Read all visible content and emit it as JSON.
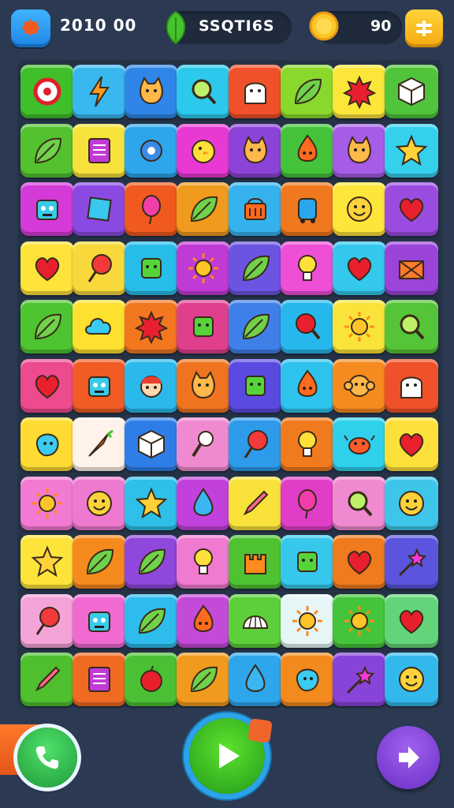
{
  "topbar": {
    "score_text": "2010 00",
    "label": "SSQTI6S",
    "coins": "90"
  },
  "colors": {
    "background": "#2b3a52",
    "board": "#253246"
  },
  "board": {
    "rows": [
      [
        {
          "c": "#3fbf2a",
          "i": "target-icon"
        },
        {
          "c": "#39b8f0",
          "i": "lightning-icon"
        },
        {
          "c": "#2f86e8",
          "i": "cat-face-icon"
        },
        {
          "c": "#2cc9ec",
          "i": "magnifier-icon"
        },
        {
          "c": "#f0502a",
          "i": "ghost-face-icon"
        },
        {
          "c": "#8ad82c",
          "i": "leaf-icon"
        },
        {
          "c": "#fde63a",
          "i": "spiky-ball-icon"
        },
        {
          "c": "#50c43a",
          "i": "cube-icon"
        }
      ],
      [
        {
          "c": "#53c22e",
          "i": "leaf-icon"
        },
        {
          "c": "#f6e23a",
          "i": "note-icon"
        },
        {
          "c": "#2ea6ec",
          "i": "gear-icon"
        },
        {
          "c": "#e83ad2",
          "i": "chick-icon"
        },
        {
          "c": "#8c43d8",
          "i": "cat-face-icon"
        },
        {
          "c": "#44c33a",
          "i": "flame-face-icon"
        },
        {
          "c": "#a65ce6",
          "i": "cat-face-icon"
        },
        {
          "c": "#35d0ec",
          "i": "star-icon"
        }
      ],
      [
        {
          "c": "#d43ad8",
          "i": "robot-icon"
        },
        {
          "c": "#8a4ae2",
          "i": "gem-icon"
        },
        {
          "c": "#f05a1e",
          "i": "balloon-icon"
        },
        {
          "c": "#f09a1e",
          "i": "leaf-icon"
        },
        {
          "c": "#35b2ee",
          "i": "basket-icon"
        },
        {
          "c": "#f0781e",
          "i": "lantern-icon"
        },
        {
          "c": "#fde63a",
          "i": "smiley-icon"
        },
        {
          "c": "#9a4ce0",
          "i": "heart-icon"
        }
      ],
      [
        {
          "c": "#fde33a",
          "i": "heart-icon"
        },
        {
          "c": "#f8d83a",
          "i": "lollipop-icon"
        },
        {
          "c": "#27bde8",
          "i": "square-face-icon"
        },
        {
          "c": "#c03ad6",
          "i": "sun-icon"
        },
        {
          "c": "#6c54e2",
          "i": "leaf-icon"
        },
        {
          "c": "#ef4fd6",
          "i": "bulb-icon"
        },
        {
          "c": "#33c8ec",
          "i": "heart-icon"
        },
        {
          "c": "#9a44da",
          "i": "box-icon"
        }
      ],
      [
        {
          "c": "#4fc431",
          "i": "leaf-icon"
        },
        {
          "c": "#fde12e",
          "i": "cloud-icon"
        },
        {
          "c": "#f3771f",
          "i": "spiky-ball-icon"
        },
        {
          "c": "#e03f8e",
          "i": "square-face-icon"
        },
        {
          "c": "#3f7fe8",
          "i": "leaf-icon"
        },
        {
          "c": "#26b8ec",
          "i": "racket-icon"
        },
        {
          "c": "#fbe43a",
          "i": "sun-icon"
        },
        {
          "c": "#55c438",
          "i": "magnifier-icon"
        }
      ],
      [
        {
          "c": "#ee4a8e",
          "i": "heart-icon"
        },
        {
          "c": "#f05c24",
          "i": "robot-icon"
        },
        {
          "c": "#2bb9ec",
          "i": "face-icon"
        },
        {
          "c": "#f07420",
          "i": "cat-face-icon"
        },
        {
          "c": "#5b4ae0",
          "i": "square-face-icon"
        },
        {
          "c": "#2ec3ec",
          "i": "flame-face-icon"
        },
        {
          "c": "#f58a1e",
          "i": "monkey-face-icon"
        },
        {
          "c": "#f0502a",
          "i": "ghost-face-icon"
        }
      ],
      [
        {
          "c": "#fddb32",
          "i": "blob-icon"
        },
        {
          "c": "#fff2ea",
          "i": "carrot-icon"
        },
        {
          "c": "#2f7ee8",
          "i": "cube-icon"
        },
        {
          "c": "#f08ad0",
          "i": "pin-icon"
        },
        {
          "c": "#2e9aea",
          "i": "lollipop-icon"
        },
        {
          "c": "#f07a1e",
          "i": "bulb-icon"
        },
        {
          "c": "#2ed0ec",
          "i": "crab-icon"
        },
        {
          "c": "#fde03a",
          "i": "heart-icon"
        }
      ],
      [
        {
          "c": "#f27ad2",
          "i": "sun-icon"
        },
        {
          "c": "#ee7ad0",
          "i": "smiley-icon"
        },
        {
          "c": "#2ec0e8",
          "i": "star-icon"
        },
        {
          "c": "#c241dc",
          "i": "drop-icon"
        },
        {
          "c": "#f8e23a",
          "i": "pencil-icon"
        },
        {
          "c": "#e03ec6",
          "i": "balloon-icon"
        },
        {
          "c": "#f08ad0",
          "i": "magnifier-icon"
        },
        {
          "c": "#3ec6ea",
          "i": "smiley-icon"
        }
      ],
      [
        {
          "c": "#fde33a",
          "i": "star-icon"
        },
        {
          "c": "#f58a1e",
          "i": "leaf-icon"
        },
        {
          "c": "#8f47dc",
          "i": "leaf-icon"
        },
        {
          "c": "#f07ad0",
          "i": "bulb-icon"
        },
        {
          "c": "#4fc232",
          "i": "castle-icon"
        },
        {
          "c": "#36c8ec",
          "i": "square-face-icon"
        },
        {
          "c": "#f07a1e",
          "i": "heart-icon"
        },
        {
          "c": "#5a55dc",
          "i": "wand-icon"
        }
      ],
      [
        {
          "c": "#f5a4d8",
          "i": "lollipop-icon"
        },
        {
          "c": "#f06ad2",
          "i": "robot-icon"
        },
        {
          "c": "#2ebcec",
          "i": "leaf-icon"
        },
        {
          "c": "#c44ad8",
          "i": "flame-face-icon"
        },
        {
          "c": "#5ccf3a",
          "i": "shell-icon"
        },
        {
          "c": "#e6f6f6",
          "i": "sun-icon"
        },
        {
          "c": "#44c43a",
          "i": "sun-icon"
        },
        {
          "c": "#64d47a",
          "i": "heart-icon"
        }
      ],
      [
        {
          "c": "#4fbf2e",
          "i": "pencil-icon"
        },
        {
          "c": "#f06a22",
          "i": "note-icon"
        },
        {
          "c": "#4cc034",
          "i": "apple-icon"
        },
        {
          "c": "#f09a1e",
          "i": "leaf-icon"
        },
        {
          "c": "#2ea6ec",
          "i": "drop-icon"
        },
        {
          "c": "#f38a1e",
          "i": "blob-icon"
        },
        {
          "c": "#8843d8",
          "i": "wand-icon"
        },
        {
          "c": "#33b8ec",
          "i": "smiley-icon"
        }
      ]
    ]
  },
  "buttons": {
    "call": "phone-icon",
    "play": "play-icon",
    "next": "arrow-right-icon"
  }
}
